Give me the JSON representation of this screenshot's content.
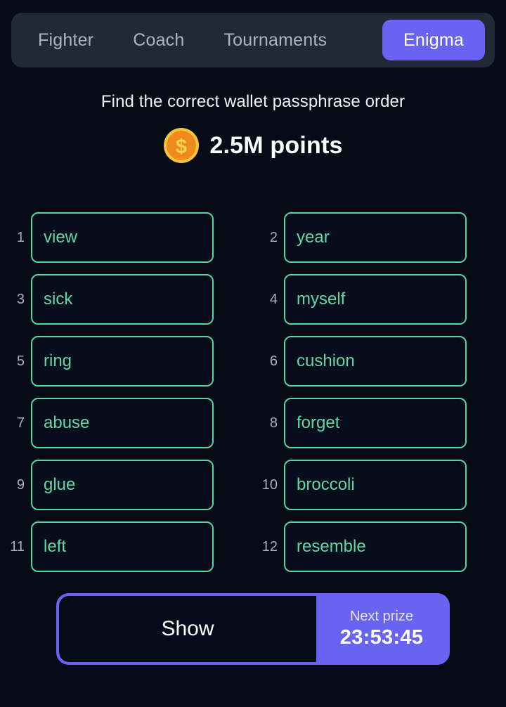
{
  "nav": {
    "tabs": [
      {
        "label": "Fighter",
        "active": false
      },
      {
        "label": "Coach",
        "active": false
      },
      {
        "label": "Tournaments",
        "active": false
      },
      {
        "label": "Enigma",
        "active": true
      }
    ]
  },
  "prompt": {
    "text": "Find the correct wallet passphrase order"
  },
  "prize": {
    "icon": "coin-icon",
    "amount": "2.5M points"
  },
  "words": [
    {
      "index": "1",
      "word": "view"
    },
    {
      "index": "2",
      "word": "year"
    },
    {
      "index": "3",
      "word": "sick"
    },
    {
      "index": "4",
      "word": "myself"
    },
    {
      "index": "5",
      "word": "ring"
    },
    {
      "index": "6",
      "word": "cushion"
    },
    {
      "index": "7",
      "word": "abuse"
    },
    {
      "index": "8",
      "word": "forget"
    },
    {
      "index": "9",
      "word": "glue"
    },
    {
      "index": "10",
      "word": "broccoli"
    },
    {
      "index": "11",
      "word": "left"
    },
    {
      "index": "12",
      "word": "resemble"
    }
  ],
  "actions": {
    "show_label": "Show",
    "next_prize_label": "Next prize",
    "next_prize_time": "23:53:45"
  },
  "colors": {
    "background": "#060b17",
    "nav_background": "#212836",
    "accent_purple": "#6a63f2",
    "tile_green": "#55d6a0",
    "tile_text_green": "#5fd9a6",
    "muted_text": "#a6afbe",
    "coin_outer": "#f0c03a",
    "coin_inner": "#f08a1e"
  }
}
